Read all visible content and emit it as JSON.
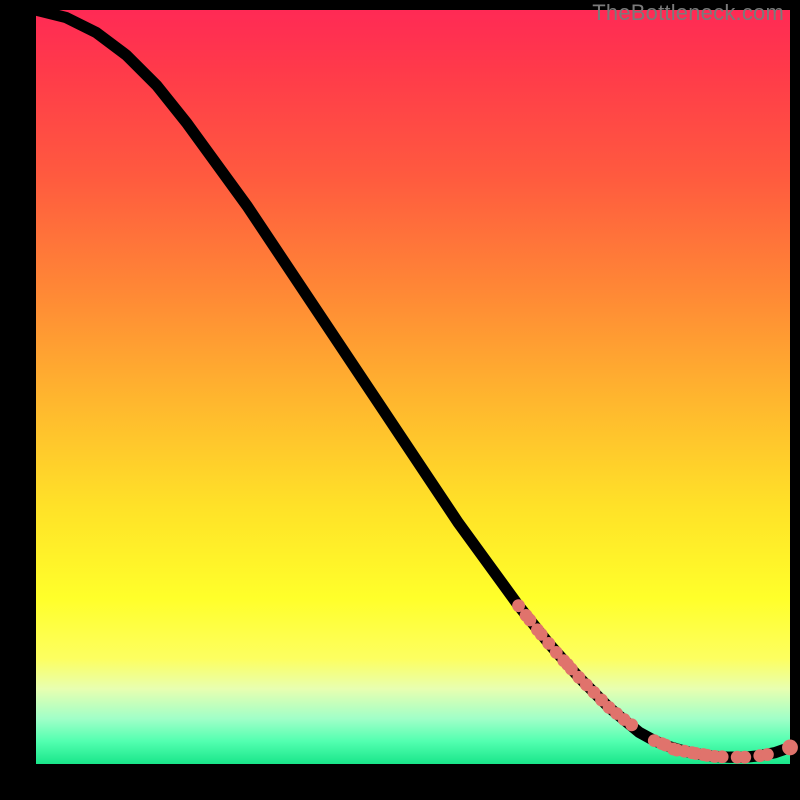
{
  "watermark": "TheBottleneck.com",
  "colors": {
    "accent_dot": "#e0736c",
    "curve": "#000000",
    "gradient_top": "#ff2a55",
    "gradient_bottom": "#19e68a",
    "background": "#000000"
  },
  "chart_data": {
    "type": "line",
    "title": "",
    "xlabel": "",
    "ylabel": "",
    "xlim": [
      0,
      100
    ],
    "ylim": [
      0,
      100
    ],
    "curve": {
      "x": [
        0,
        4,
        8,
        12,
        16,
        20,
        24,
        28,
        32,
        36,
        40,
        44,
        48,
        52,
        56,
        60,
        64,
        68,
        72,
        76,
        80,
        82,
        84,
        86,
        88,
        90,
        92,
        94,
        96,
        98,
        100
      ],
      "y": [
        100,
        99,
        97,
        94,
        90,
        85,
        79.5,
        74,
        68,
        62,
        56,
        50,
        44,
        38,
        32,
        26.5,
        21,
        16,
        11.5,
        7.5,
        4.2,
        3.1,
        2.3,
        1.7,
        1.3,
        1.0,
        0.9,
        0.9,
        1.1,
        1.5,
        2.2
      ]
    },
    "series": [
      {
        "name": "points-on-curve",
        "mode": "markers",
        "x": [
          64,
          65,
          65.5,
          66.5,
          67,
          68,
          69,
          70,
          70.5,
          71,
          72,
          73,
          74,
          75,
          76,
          77,
          78,
          79,
          82,
          83,
          83.5,
          84.5,
          85,
          86,
          87,
          87.5,
          88.5,
          89,
          90,
          91,
          93,
          94,
          96,
          97,
          100
        ],
        "y": [
          21,
          19.7,
          19.1,
          17.8,
          17.2,
          16,
          14.8,
          13.7,
          13.2,
          12.6,
          11.5,
          10.5,
          9.5,
          8.5,
          7.5,
          6.7,
          5.9,
          5.2,
          3.1,
          2.7,
          2.5,
          2.0,
          1.85,
          1.7,
          1.5,
          1.4,
          1.25,
          1.15,
          1.0,
          0.95,
          0.9,
          0.9,
          1.1,
          1.25,
          2.2
        ]
      }
    ]
  }
}
